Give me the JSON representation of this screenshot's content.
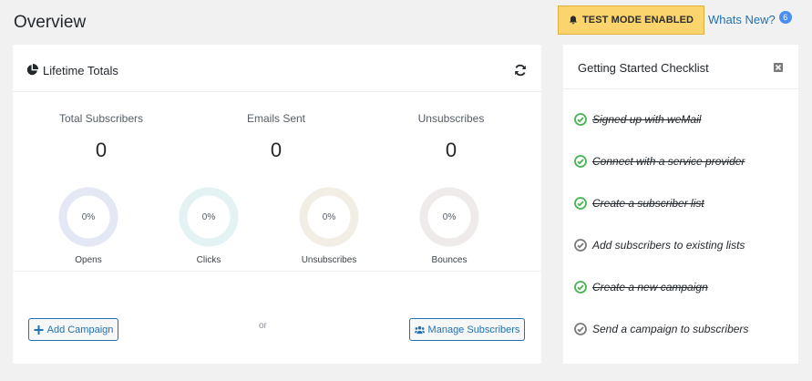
{
  "page": {
    "title": "Overview"
  },
  "topbar": {
    "test_mode_label": "TEST MODE ENABLED",
    "whats_new_label": "Whats New?",
    "whats_new_count": "6"
  },
  "lifetime": {
    "title": "Lifetime Totals",
    "stats": [
      {
        "label": "Total Subscribers",
        "value": "0"
      },
      {
        "label": "Emails Sent",
        "value": "0"
      },
      {
        "label": "Unsubscribes",
        "value": "0"
      }
    ],
    "rings": [
      {
        "label": "Opens",
        "value": "0%",
        "color": "#e3e8f4"
      },
      {
        "label": "Clicks",
        "value": "0%",
        "color": "#e3f3f4"
      },
      {
        "label": "Unsubscribes",
        "value": "0%",
        "color": "#f3eee5"
      },
      {
        "label": "Bounces",
        "value": "0%",
        "color": "#efebeb"
      }
    ],
    "add_campaign_label": "Add Campaign",
    "or_label": "or",
    "manage_subscribers_label": "Manage Subscribers"
  },
  "checklist": {
    "title": "Getting Started Checklist",
    "items": [
      {
        "label": "Signed up with weMail",
        "done": true
      },
      {
        "label": "Connect with a service provider",
        "done": true
      },
      {
        "label": "Create a subscriber list",
        "done": true
      },
      {
        "label": "Add subscribers to existing lists",
        "done": false
      },
      {
        "label": "Create a new campaign",
        "done": true
      },
      {
        "label": "Send a campaign to subscribers",
        "done": false
      }
    ]
  },
  "colors": {
    "accent": "#2271b1",
    "test_mode_bg": "#fbd46d",
    "check_done": "#46b450",
    "check_pending": "#7a7a7a"
  },
  "icons": {
    "bell": "bell-icon",
    "pie": "pie-chart-icon",
    "refresh": "refresh-icon",
    "close": "close-icon",
    "plus": "plus-icon",
    "users": "users-icon",
    "check": "check-circle-icon"
  }
}
